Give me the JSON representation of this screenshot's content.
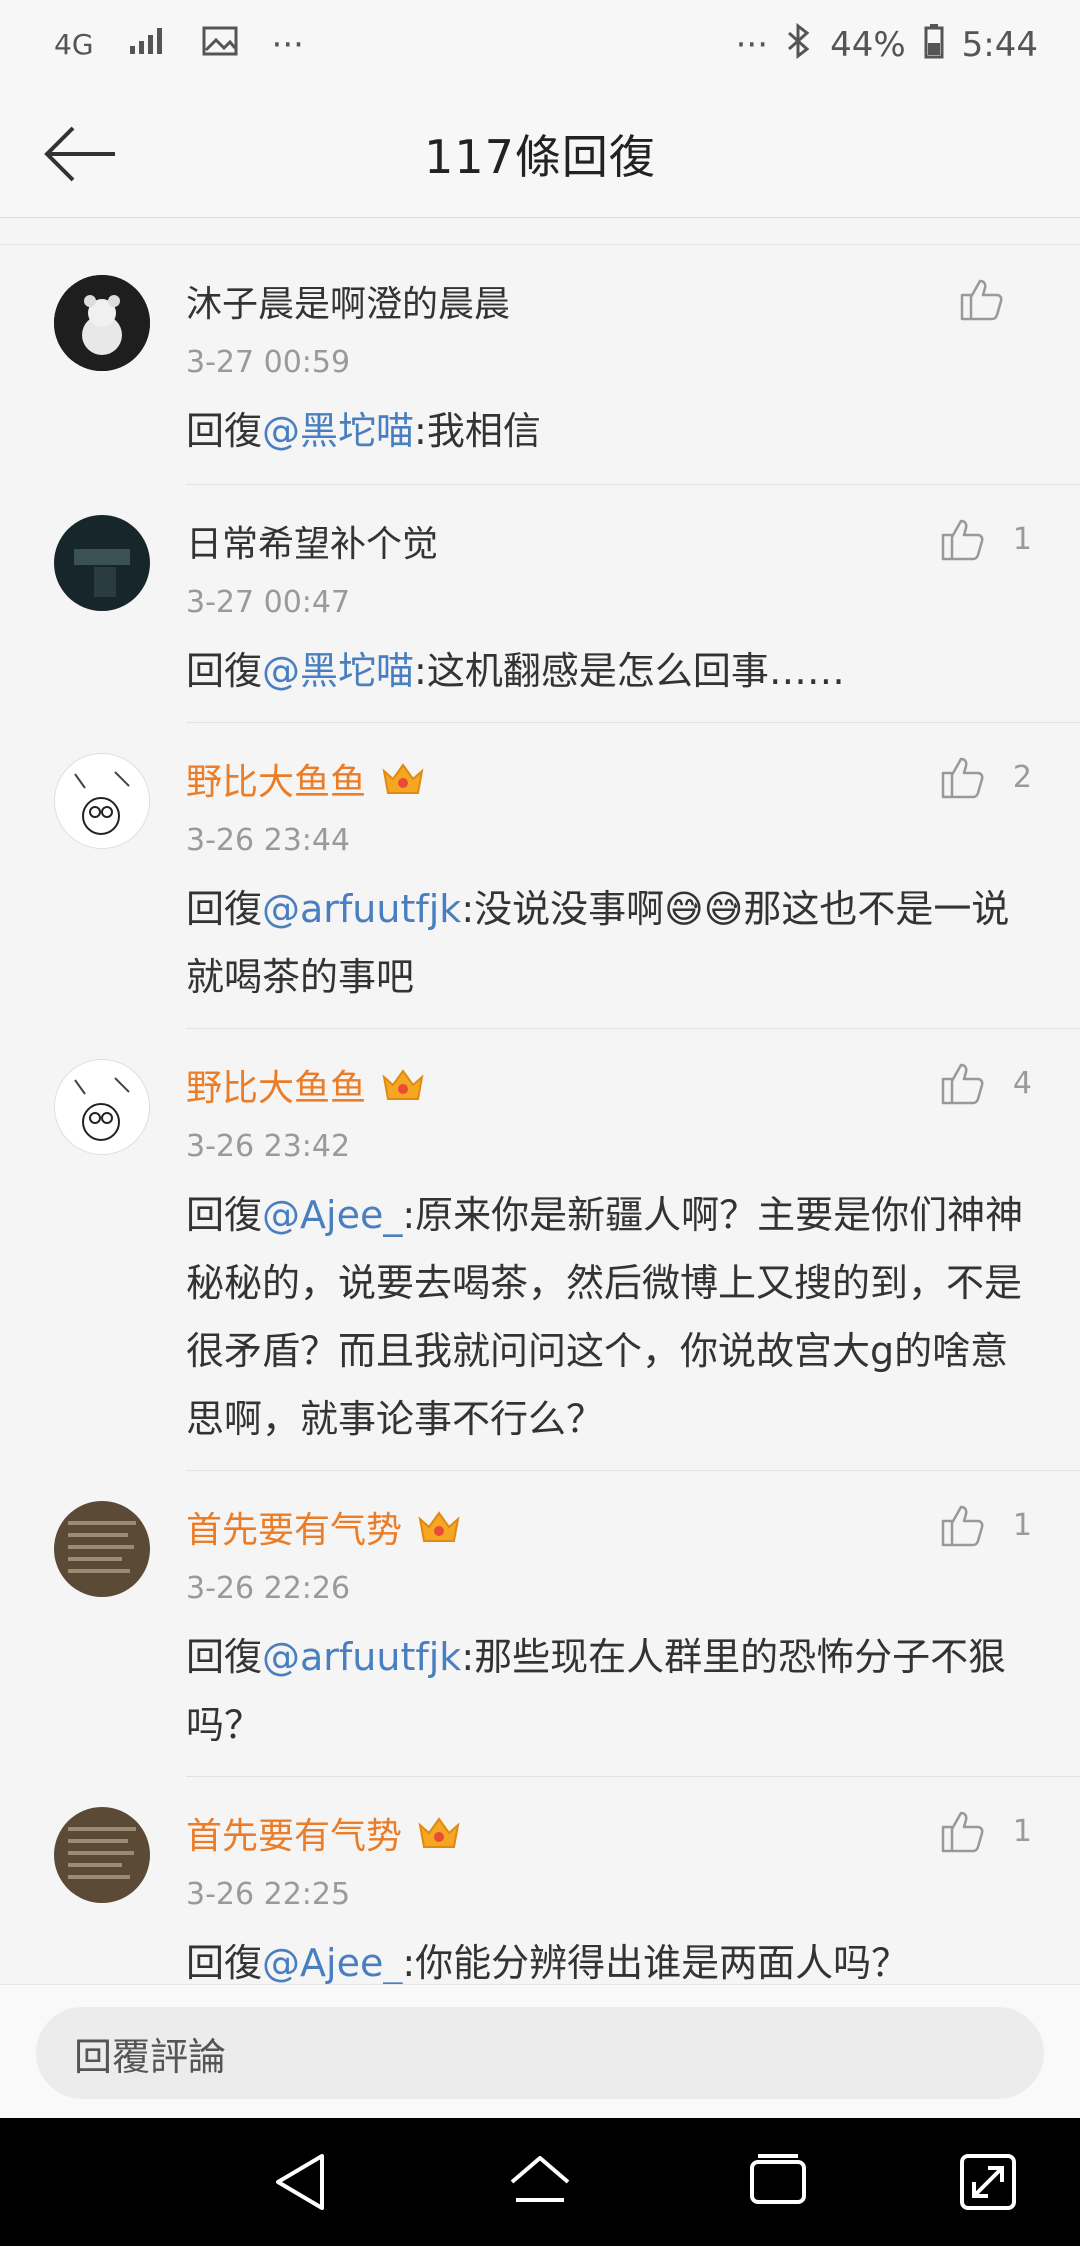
{
  "status_bar": {
    "network": "4G",
    "more": "···",
    "more_right": "···",
    "battery": "44%",
    "time": "5:44"
  },
  "header": {
    "title": "117條回復"
  },
  "comments": [
    {
      "username": "沐子晨是啊澄的晨晨",
      "vip": false,
      "time": "3-27 00:59",
      "likes": "",
      "reply_prefix": "回復",
      "mention": "@黑坨喵",
      "text": ":我相信"
    },
    {
      "username": "日常希望补个觉",
      "vip": false,
      "time": "3-27 00:47",
      "likes": "1",
      "reply_prefix": "回復",
      "mention": "@黑坨喵",
      "text": ":这机翻感是怎么回事……"
    },
    {
      "username": "野比大鱼鱼",
      "vip": true,
      "time": "3-26 23:44",
      "likes": "2",
      "reply_prefix": "回復",
      "mention": "@arfuutfjk",
      "text": ":没说没事啊😅😅那这也不是一说就喝茶的事吧"
    },
    {
      "username": "野比大鱼鱼",
      "vip": true,
      "time": "3-26 23:42",
      "likes": "4",
      "reply_prefix": "回復",
      "mention": "@Ajee_",
      "text": ":原来你是新疆人啊？主要是你们神神秘秘的，说要去喝茶，然后微博上又搜的到，不是很矛盾？而且我就问问这个，你说故宫大g的啥意思啊，就事论事不行么？"
    },
    {
      "username": "首先要有气势",
      "vip": true,
      "time": "3-26 22:26",
      "likes": "1",
      "reply_prefix": "回復",
      "mention": "@arfuutfjk",
      "text": ":那些现在人群里的恐怖分子不狠吗？"
    },
    {
      "username": "首先要有气势",
      "vip": true,
      "time": "3-26 22:25",
      "likes": "1",
      "reply_prefix": "回復",
      "mention": "@Ajee_",
      "text": ":你能分辨得出谁是两面人吗？"
    }
  ],
  "reply_input": {
    "placeholder": "回覆評論"
  },
  "colors": {
    "accent_vip": "#eb7d28",
    "mention": "#4a7fbf"
  }
}
